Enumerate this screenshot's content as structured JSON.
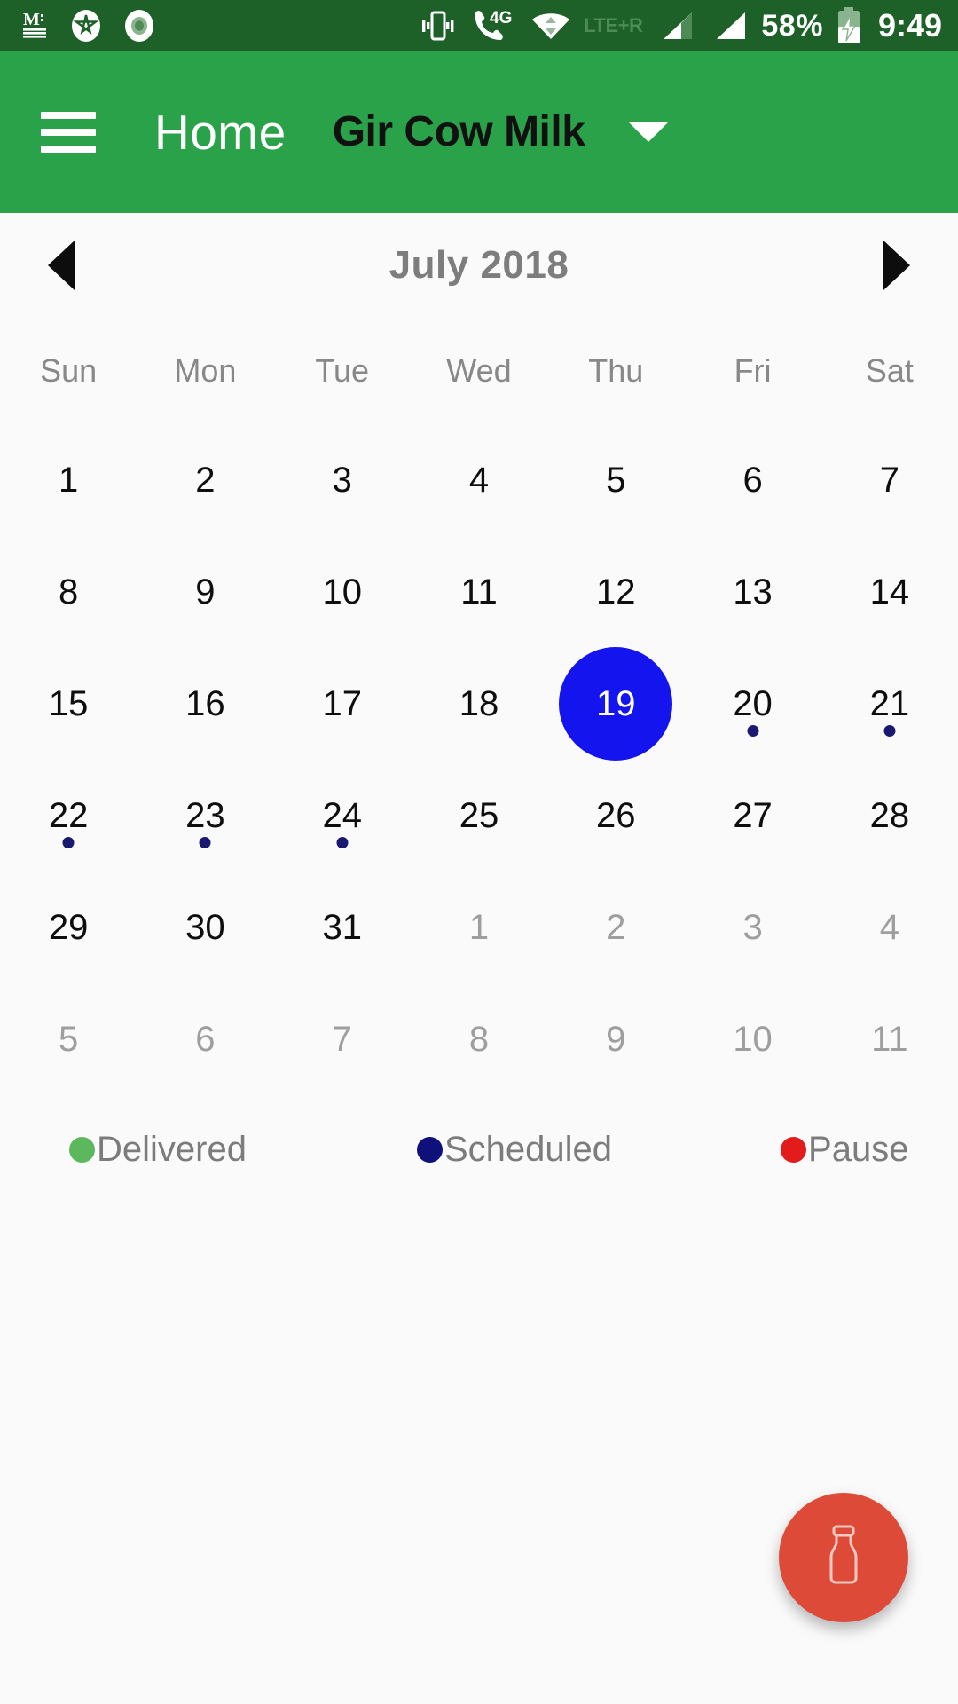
{
  "status_bar": {
    "icons": [
      "medium-m-icon",
      "star-badge-icon",
      "record-circle-icon",
      "vibrate-icon",
      "call-4g-icon",
      "wifi-icon"
    ],
    "network_label": "LTE+R",
    "mobile_data_label": "4G",
    "battery_percent": "58%",
    "battery_state_icon": "battery-charging-icon",
    "clock": "9:49"
  },
  "app_bar": {
    "menu_icon": "hamburger-menu-icon",
    "title": "Home",
    "subtitle": "Gir Cow Milk",
    "dropdown_icon": "caret-down-icon"
  },
  "calendar": {
    "prev_icon": "chevron-left-icon",
    "next_icon": "chevron-right-icon",
    "month_title": "July 2018",
    "weekdays": [
      "Sun",
      "Mon",
      "Tue",
      "Wed",
      "Thu",
      "Fri",
      "Sat"
    ],
    "weeks": [
      [
        {
          "d": "1",
          "other": false,
          "sel": false,
          "dot": ""
        },
        {
          "d": "2",
          "other": false,
          "sel": false,
          "dot": ""
        },
        {
          "d": "3",
          "other": false,
          "sel": false,
          "dot": ""
        },
        {
          "d": "4",
          "other": false,
          "sel": false,
          "dot": ""
        },
        {
          "d": "5",
          "other": false,
          "sel": false,
          "dot": ""
        },
        {
          "d": "6",
          "other": false,
          "sel": false,
          "dot": ""
        },
        {
          "d": "7",
          "other": false,
          "sel": false,
          "dot": ""
        }
      ],
      [
        {
          "d": "8",
          "other": false,
          "sel": false,
          "dot": ""
        },
        {
          "d": "9",
          "other": false,
          "sel": false,
          "dot": ""
        },
        {
          "d": "10",
          "other": false,
          "sel": false,
          "dot": ""
        },
        {
          "d": "11",
          "other": false,
          "sel": false,
          "dot": ""
        },
        {
          "d": "12",
          "other": false,
          "sel": false,
          "dot": ""
        },
        {
          "d": "13",
          "other": false,
          "sel": false,
          "dot": ""
        },
        {
          "d": "14",
          "other": false,
          "sel": false,
          "dot": ""
        }
      ],
      [
        {
          "d": "15",
          "other": false,
          "sel": false,
          "dot": ""
        },
        {
          "d": "16",
          "other": false,
          "sel": false,
          "dot": ""
        },
        {
          "d": "17",
          "other": false,
          "sel": false,
          "dot": ""
        },
        {
          "d": "18",
          "other": false,
          "sel": false,
          "dot": ""
        },
        {
          "d": "19",
          "other": false,
          "sel": true,
          "dot": ""
        },
        {
          "d": "20",
          "other": false,
          "sel": false,
          "dot": "scheduled"
        },
        {
          "d": "21",
          "other": false,
          "sel": false,
          "dot": "scheduled"
        }
      ],
      [
        {
          "d": "22",
          "other": false,
          "sel": false,
          "dot": "scheduled"
        },
        {
          "d": "23",
          "other": false,
          "sel": false,
          "dot": "scheduled"
        },
        {
          "d": "24",
          "other": false,
          "sel": false,
          "dot": "scheduled"
        },
        {
          "d": "25",
          "other": false,
          "sel": false,
          "dot": ""
        },
        {
          "d": "26",
          "other": false,
          "sel": false,
          "dot": ""
        },
        {
          "d": "27",
          "other": false,
          "sel": false,
          "dot": ""
        },
        {
          "d": "28",
          "other": false,
          "sel": false,
          "dot": ""
        }
      ],
      [
        {
          "d": "29",
          "other": false,
          "sel": false,
          "dot": ""
        },
        {
          "d": "30",
          "other": false,
          "sel": false,
          "dot": ""
        },
        {
          "d": "31",
          "other": false,
          "sel": false,
          "dot": ""
        },
        {
          "d": "1",
          "other": true,
          "sel": false,
          "dot": ""
        },
        {
          "d": "2",
          "other": true,
          "sel": false,
          "dot": ""
        },
        {
          "d": "3",
          "other": true,
          "sel": false,
          "dot": ""
        },
        {
          "d": "4",
          "other": true,
          "sel": false,
          "dot": ""
        }
      ],
      [
        {
          "d": "5",
          "other": true,
          "sel": false,
          "dot": ""
        },
        {
          "d": "6",
          "other": true,
          "sel": false,
          "dot": ""
        },
        {
          "d": "7",
          "other": true,
          "sel": false,
          "dot": ""
        },
        {
          "d": "8",
          "other": true,
          "sel": false,
          "dot": ""
        },
        {
          "d": "9",
          "other": true,
          "sel": false,
          "dot": ""
        },
        {
          "d": "10",
          "other": true,
          "sel": false,
          "dot": ""
        },
        {
          "d": "11",
          "other": true,
          "sel": false,
          "dot": ""
        }
      ]
    ]
  },
  "legend": [
    {
      "label": "Delivered",
      "color": "#5cb85c",
      "cls": "green"
    },
    {
      "label": "Scheduled",
      "color": "#10107a",
      "cls": "navy"
    },
    {
      "label": "Pause",
      "color": "#e31b1b",
      "cls": "red"
    }
  ],
  "fab": {
    "icon": "milk-bottle-icon",
    "color": "#dd4a38"
  },
  "colors": {
    "status_bar_bg": "#1d6128",
    "app_bar_bg": "#2aa24a",
    "page_bg": "#fafafa",
    "selected_day": "#1414ef",
    "scheduled_dot": "#191970"
  }
}
